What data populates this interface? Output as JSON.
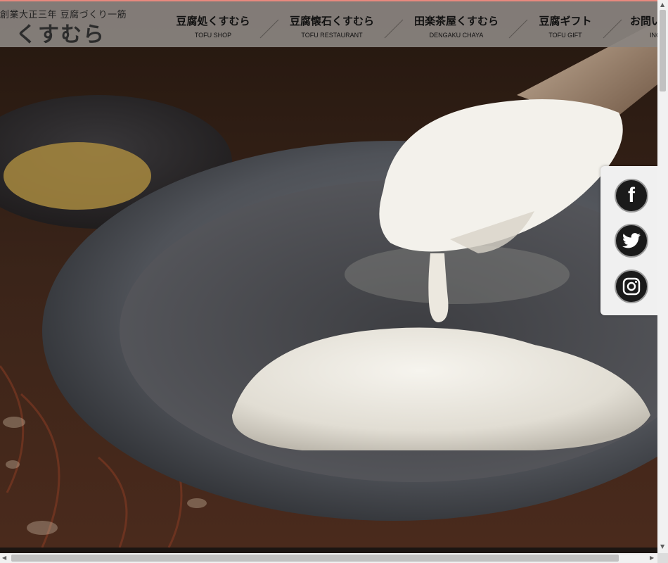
{
  "header": {
    "tagline": "創業大正三年 豆腐づくり一筋",
    "logo_text": "くすむら",
    "nav": [
      {
        "jp": "豆腐処くすむら",
        "en": "TOFU SHOP"
      },
      {
        "jp": "豆腐懐石くすむら",
        "en": "TOFU RESTAURANT"
      },
      {
        "jp": "田楽茶屋くすむら",
        "en": "DENGAKU CHAYA"
      },
      {
        "jp": "豆腐ギフト",
        "en": "TOFU GIFT"
      },
      {
        "jp": "お問い",
        "en": "INQ"
      }
    ]
  },
  "social": [
    {
      "name": "facebook",
      "icon": "facebook-icon",
      "glyph": "f"
    },
    {
      "name": "twitter",
      "icon": "twitter-icon"
    },
    {
      "name": "instagram",
      "icon": "instagram-icon"
    }
  ],
  "colors": {
    "accent_line": "#e8897e",
    "header_bg": "#8a8480"
  },
  "scrollbar": {
    "up": "▲",
    "down": "▼",
    "left": "◀",
    "right": "▶"
  }
}
